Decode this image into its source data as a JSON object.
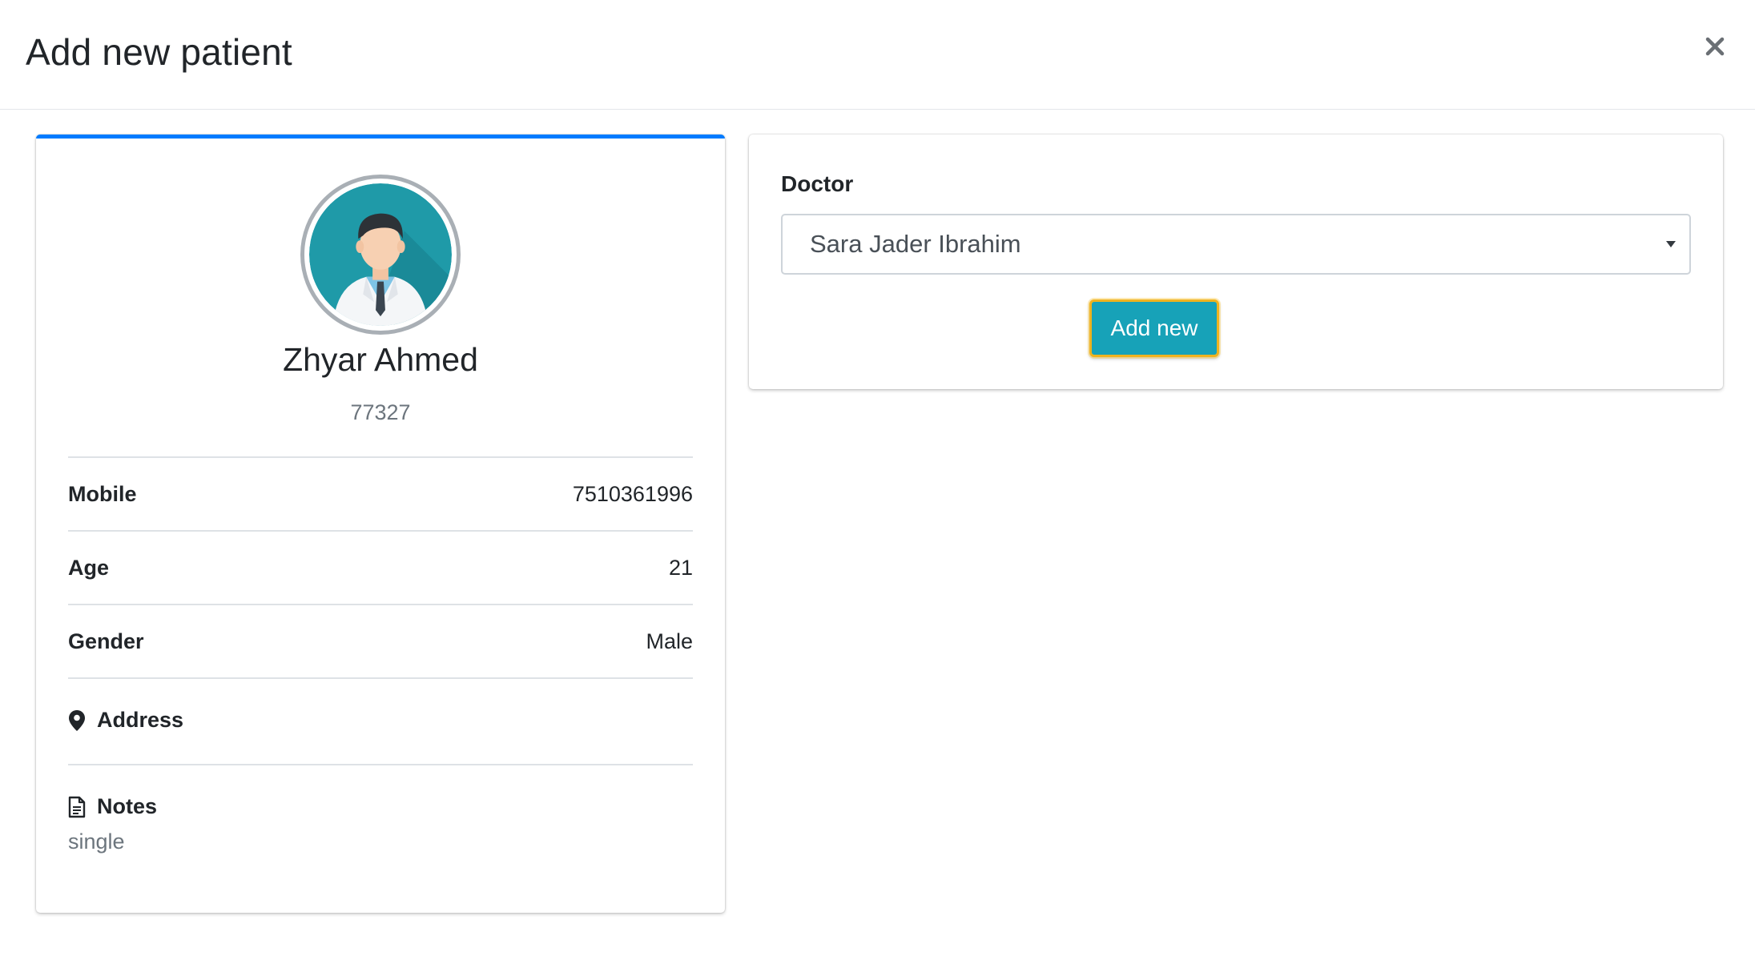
{
  "modal": {
    "title": "Add new patient",
    "close_icon": "close-icon"
  },
  "patient": {
    "name": "Zhyar Ahmed",
    "id": "77327",
    "avatar_icon": "doctor-avatar-icon",
    "fields": [
      {
        "label": "Mobile",
        "value": "7510361996"
      },
      {
        "label": "Age",
        "value": "21"
      },
      {
        "label": "Gender",
        "value": "Male"
      }
    ],
    "address": {
      "label": "Address",
      "icon": "map-marker-icon"
    },
    "notes": {
      "label": "Notes",
      "icon": "file-text-icon",
      "value": "single"
    }
  },
  "doctor": {
    "label": "Doctor",
    "selected": "Sara Jader Ibrahim",
    "caret_icon": "caret-down-icon"
  },
  "actions": {
    "add_label": "Add new"
  },
  "colors": {
    "accent_blue": "#007bff",
    "button_teal": "#17a2b8",
    "focus_ring": "#f0b31f",
    "avatar_bg": "#1f9aa8"
  }
}
